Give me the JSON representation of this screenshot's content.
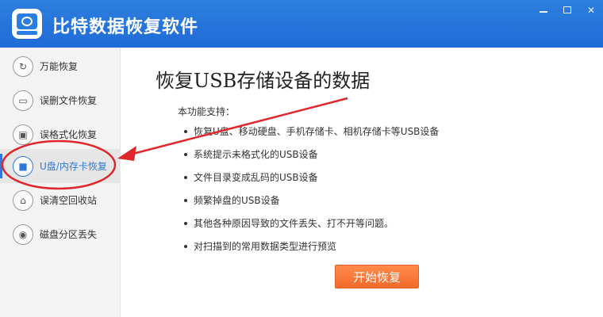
{
  "app": {
    "title": "比特数据恢复软件"
  },
  "window_controls": {
    "minimize": "minimize",
    "maximize": "maximize",
    "close": "close"
  },
  "sidebar": {
    "items": [
      {
        "label": "万能恢复",
        "icon": "refresh-icon",
        "active": false
      },
      {
        "label": "误删文件恢复",
        "icon": "folder-icon",
        "active": false
      },
      {
        "label": "误格式化恢复",
        "icon": "drive-icon",
        "active": false
      },
      {
        "label": "U盘/内存卡恢复",
        "icon": "usb-lock-icon",
        "active": true
      },
      {
        "label": "误清空回收站",
        "icon": "trash-icon",
        "active": false
      },
      {
        "label": "磁盘分区丢失",
        "icon": "disk-icon",
        "active": false
      }
    ]
  },
  "main": {
    "title": "恢复USB存储设备的数据",
    "intro": "本功能支持：",
    "features": [
      "恢复U盘、移动硬盘、手机存储卡、相机存储卡等USB设备",
      "系统提示未格式化的USB设备",
      "文件目录变成乱码的USB设备",
      "频繁掉盘的USB设备",
      "其他各种原因导致的文件丢失、打不开等问题。",
      "对扫描到的常用数据类型进行预览"
    ],
    "start_button": "开始恢复"
  },
  "annotation": {
    "color": "#e0262a"
  },
  "colors": {
    "titlebar": "#1f6bd6",
    "accent": "#2f78d8",
    "button": "#f26a2a"
  }
}
